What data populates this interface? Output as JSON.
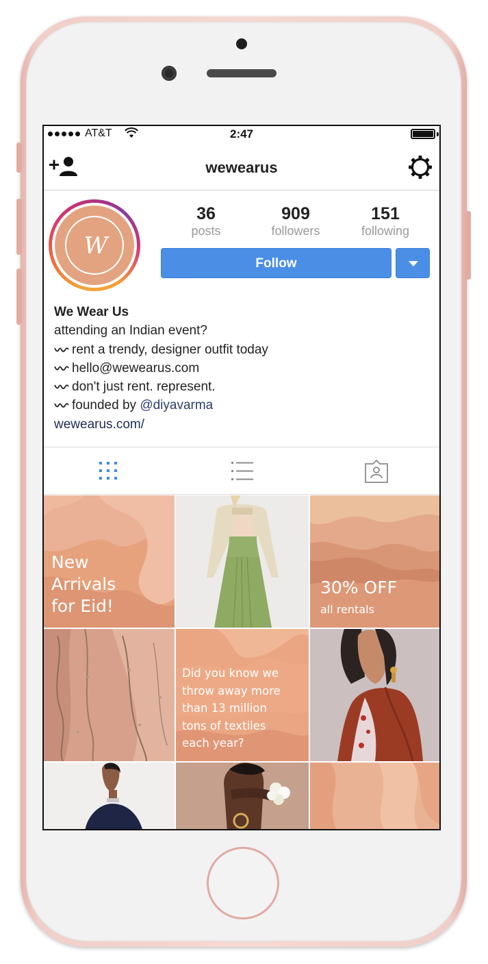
{
  "status_bar": {
    "carrier": "AT&T",
    "time": "2:47"
  },
  "nav": {
    "title": "wewearus"
  },
  "profile": {
    "avatar_letter": "W",
    "stats": [
      {
        "value": "36",
        "label": "posts"
      },
      {
        "value": "909",
        "label": "followers"
      },
      {
        "value": "151",
        "label": "following"
      }
    ],
    "follow_label": "Follow",
    "accent_color": "#4a8ee6"
  },
  "bio": {
    "name": "We Wear Us",
    "line1": "attending an Indian event?",
    "line2": "rent a trendy, designer outfit today",
    "line3": "hello@wewearus.com",
    "line4": "don't just rent. represent.",
    "line5_prefix": "founded by ",
    "line5_mention": "@diyavarma",
    "link": "wewearus.com/"
  },
  "tabs": {
    "active": "grid",
    "icons": [
      "grid-icon",
      "list-icon",
      "tagged-icon"
    ]
  },
  "grid": {
    "tile1": [
      "New",
      "Arrivals",
      "for Eid!"
    ],
    "tile3_title": "30% OFF",
    "tile3_sub": "all rentals",
    "tile5": [
      "Did you know we",
      "throw away more",
      "than 13 million",
      "tons of textiles",
      "each year?"
    ]
  }
}
